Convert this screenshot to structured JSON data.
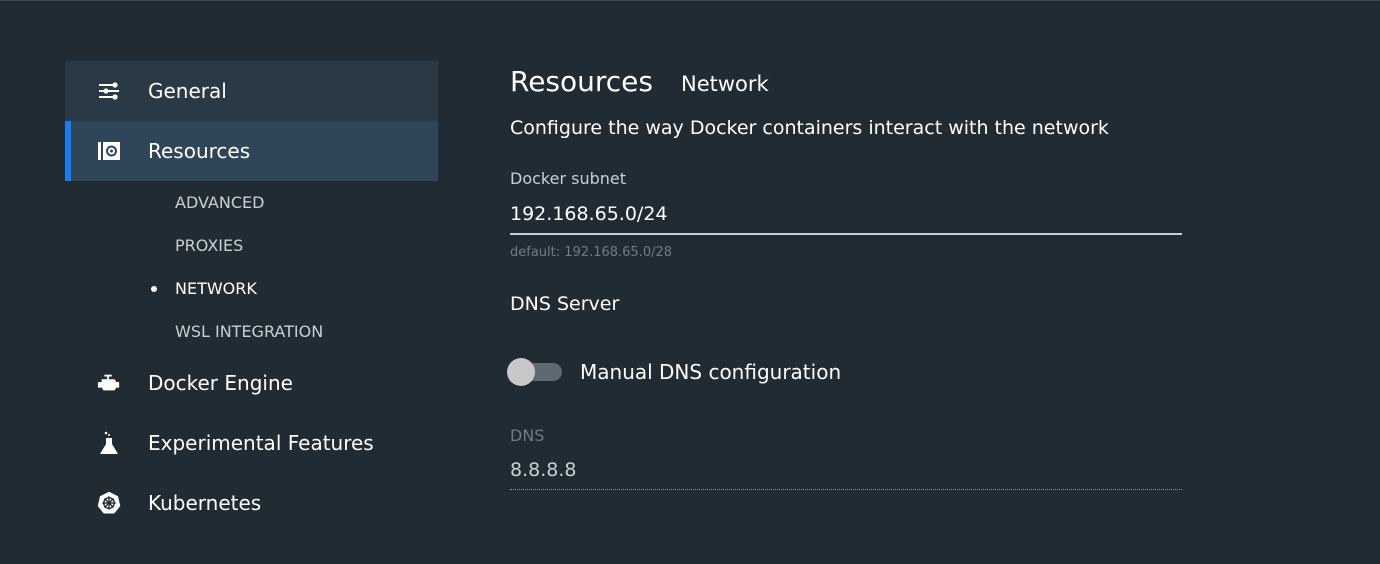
{
  "sidebar": {
    "items": [
      {
        "label": "General",
        "icon": "sliders-icon"
      },
      {
        "label": "Resources",
        "icon": "resources-icon"
      },
      {
        "label": "Docker Engine",
        "icon": "engine-icon"
      },
      {
        "label": "Experimental Features",
        "icon": "flask-icon"
      },
      {
        "label": "Kubernetes",
        "icon": "kubernetes-icon"
      }
    ],
    "subitems": [
      "ADVANCED",
      "PROXIES",
      "NETWORK",
      "WSL INTEGRATION"
    ]
  },
  "main": {
    "title": "Resources",
    "subtitle": "Network",
    "description": "Configure the way Docker containers interact with the network",
    "subnet_label": "Docker subnet",
    "subnet_value": "192.168.65.0/24",
    "subnet_hint": "default: 192.168.65.0/28",
    "dns_section": "DNS Server",
    "toggle_label": "Manual DNS configuration",
    "toggle_on": false,
    "dns_label": "DNS",
    "dns_value": "8.8.8.8"
  },
  "colors": {
    "accent": "#1a7ef2",
    "background": "#202b33"
  }
}
